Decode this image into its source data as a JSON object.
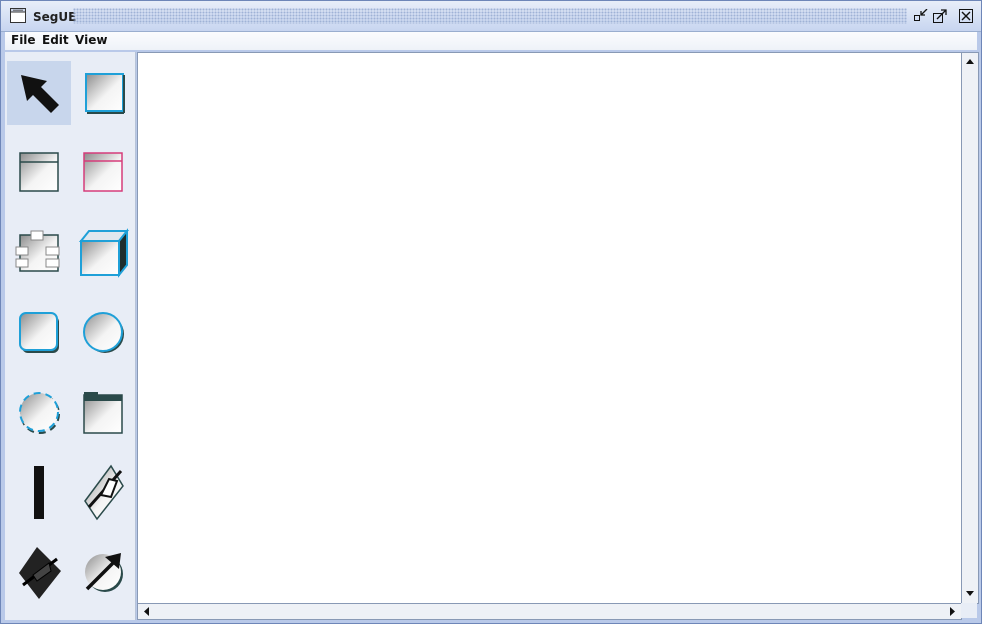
{
  "window": {
    "title": "SegUE",
    "app_icon": "window-icon",
    "controls": [
      "minimize-icon",
      "maximize-icon",
      "close-icon"
    ]
  },
  "menubar": {
    "items": [
      "File",
      "Edit",
      "View"
    ]
  },
  "palette": {
    "tools": [
      {
        "icon": "select-arrow-icon",
        "selected": true
      },
      {
        "icon": "square-icon"
      },
      {
        "icon": "class-box-icon"
      },
      {
        "icon": "pink-class-box-icon"
      },
      {
        "icon": "component-icon"
      },
      {
        "icon": "cube-node-icon"
      },
      {
        "icon": "rounded-square-icon"
      },
      {
        "icon": "circle-icon"
      },
      {
        "icon": "dashed-circle-icon"
      },
      {
        "icon": "package-icon"
      },
      {
        "icon": "vertical-bar-icon"
      },
      {
        "icon": "pen-line-icon"
      },
      {
        "icon": "diamond-pen-icon"
      },
      {
        "icon": "arrow-circle-icon"
      }
    ]
  },
  "colors": {
    "accent_blue": "#1fa0d8",
    "pink": "#d63c7a",
    "selected_tool_bg": "#c8d6ec",
    "palette_bg": "#e8edf6"
  }
}
